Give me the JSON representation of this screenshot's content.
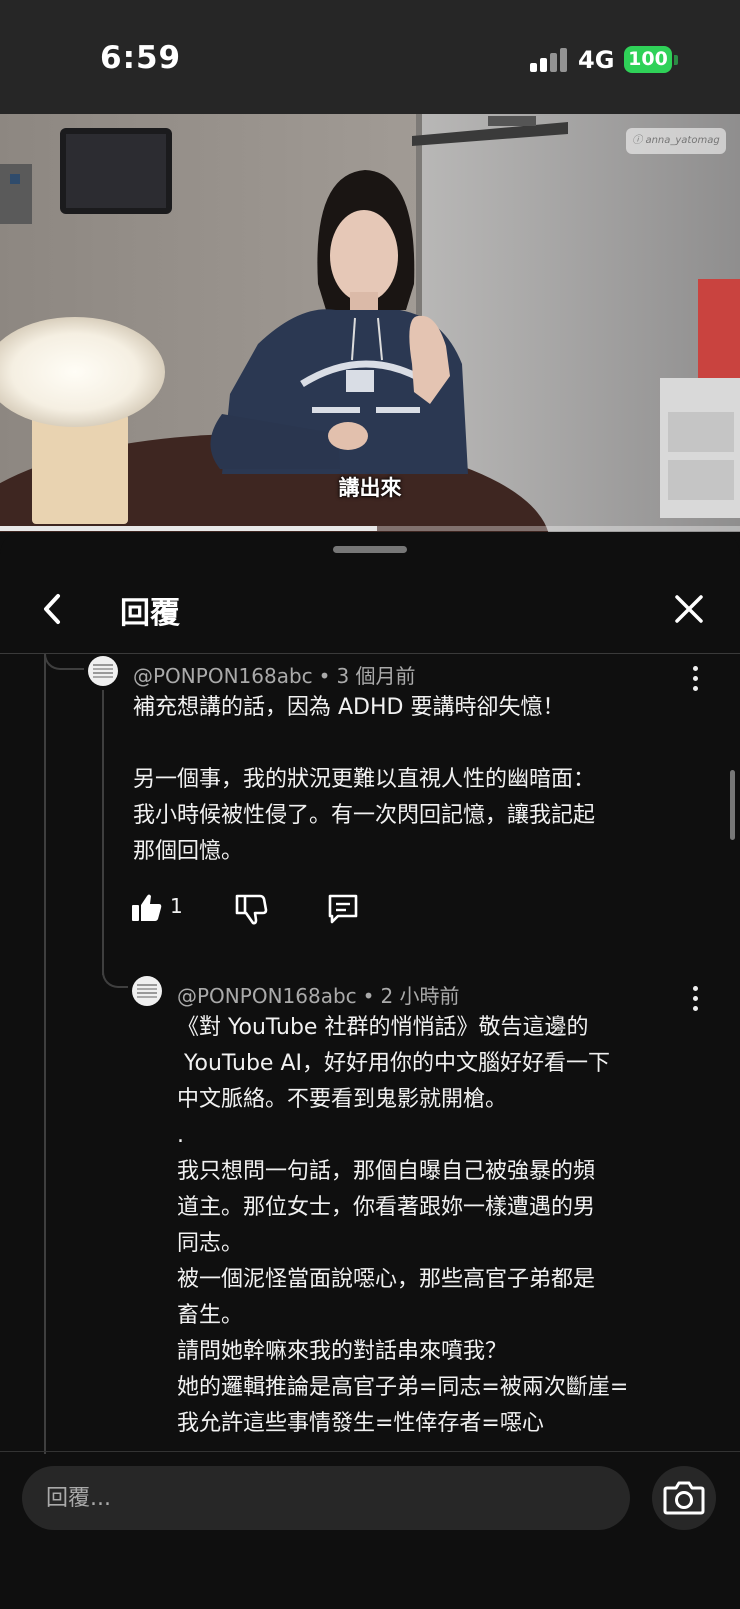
{
  "status_bar": {
    "time": "6:59",
    "network": "4G",
    "battery": "100",
    "battery_color": "#2fd158"
  },
  "video": {
    "subtitle": "講出來",
    "progress": 0.51
  },
  "sheet": {
    "title": "回覆",
    "back_icon": "chevron-left-icon",
    "close_icon": "close-icon"
  },
  "comments": [
    {
      "handle": "@PONPON168abc",
      "dot": "•",
      "time": "3 個月前",
      "text": "補充想講的話，因為 ADHD 要講時卻失憶！\n\n另一個事，我的狀況更難以直視人性的幽暗面：\n我小時候被性侵了。有一次閃回記憶，讓我記起\n那個回憶。",
      "like_count": "1",
      "icons": [
        "thumbs-up-icon",
        "thumbs-down-icon",
        "reply-icon"
      ]
    },
    {
      "handle": "@PONPON168abc",
      "dot": "•",
      "time": "2 小時前",
      "text": "《對 YouTube 社群的悄悄話》敬告這邊的\n YouTube AI，好好用你的中文腦好好看一下\n中文脈絡。不要看到鬼影就開槍。\n.\n我只想問一句話，那個自曝自己被強暴的頻\n道主。那位女士，你看著跟妳一樣遭遇的男\n同志。\n被一個泥怪當面說噁心，那些高官子弟都是\n畜生。\n請問她幹嘛來我的對話串來噴我？\n她的邏輯推論是高官子弟=同志=被兩次斷崖=\n我允許這些事情發生=性倖存者=噁心"
    }
  ],
  "composer": {
    "placeholder": "回覆...",
    "camera_icon": "camera-icon"
  }
}
